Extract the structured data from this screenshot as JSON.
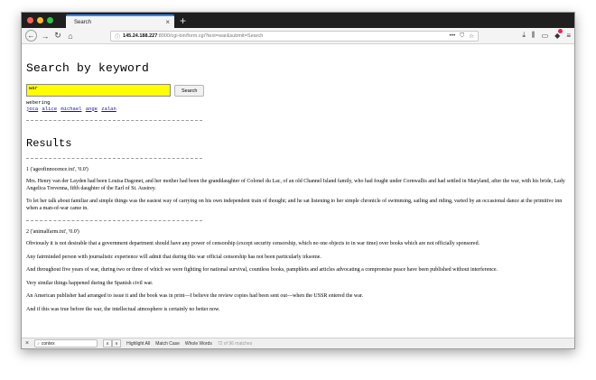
{
  "browser": {
    "tab_title": "Search",
    "tab_close": "×",
    "new_tab": "+",
    "url_host": "145.24.188.227",
    "url_rest": ":8000/cgi-bin/form.cgi?text=war&submit=Search",
    "url_actions": [
      "•••",
      "⛉",
      "☆"
    ]
  },
  "page": {
    "title": "Search by keyword",
    "search_value": "war",
    "search_button": "Search",
    "suggest_label": "webering",
    "suggest_links": [
      "joca",
      "alice",
      "michael",
      "ange",
      "zalan"
    ],
    "results_title": "Results",
    "results": [
      {
        "header": "1 ('ageofinnocence.txt', '0.0')",
        "paragraphs": [
          "Mrs. Henry van der Layden had been Louisa Dagonet, and her mother had been the granddaughter of Colonel du Lac, of an old Channel Island family, who had fought under Cornwallis and had settled in Maryland, after the war, with his bride, Lady Angelica Trevenna, fifth daughter of the Earl of St. Austrey.",
          "To let her talk about familiar and simple things was the easiest way of carrying on his own independent train of thought; and he sat listening to her simple chronicle of swimming, sailing and riding, varied by an occasional dance at the primitive inn when a man-of-war came in."
        ]
      },
      {
        "header": "2 ('animalfarm.txt', '0.0')",
        "paragraphs": [
          "Obviously it is not desirable that a government department should have any power of censorship (except security censorship, which no one objects to in war time) over books which are not officially sponsored.",
          "Any fairminded person with journalistic experience will admit that during this war official censorship has not been particularly irksome.",
          "And throughout five years of war, during two or three of which we were fighting for national survival, countless books, pamphlets and articles advocating a compromise peace have been published without interference.",
          "Very similar things happened during the Spanish civil war.",
          "An American publisher had arranged to issue it and the book was in print—I believe the review copies had been sent out—when the USSR entered the war.",
          "And if this was true before the war, the intellectual atmosphere is certainly no better now."
        ]
      }
    ]
  },
  "findbar": {
    "close": "×",
    "query": "contex",
    "prev": "∧",
    "next": "∨",
    "highlight_all": "Highlight All",
    "match_case": "Match Case",
    "whole_words": "Whole Words",
    "status": "72 of 96 matches"
  }
}
